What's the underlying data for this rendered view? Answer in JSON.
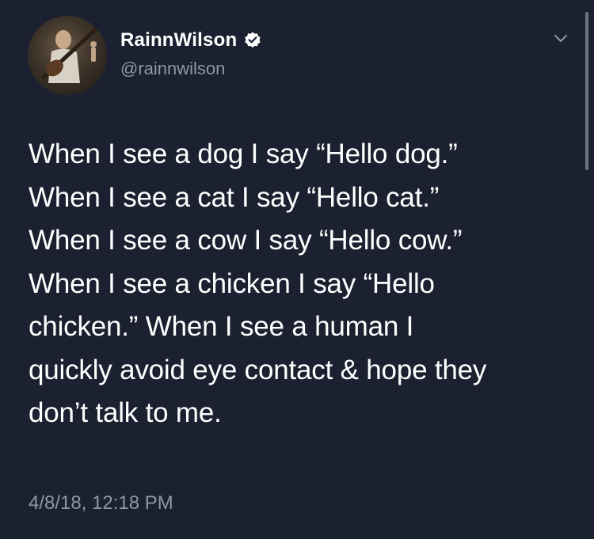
{
  "user": {
    "display_name": "RainnWilson",
    "handle": "@rainnwilson",
    "verified": true,
    "avatar_icon": "user-avatar-photo"
  },
  "tweet": {
    "text": "When I see a dog I say “Hello dog.”\nWhen I see a cat I say “Hello cat.”\nWhen I see a cow I say “Hello cow.”\nWhen I see a chicken I say “Hello\nchicken.” When I see a human I\nquickly avoid eye contact & hope they\ndon’t talk to me.",
    "timestamp": "4/8/18, 12:18 PM"
  },
  "icons": {
    "verified": "verified-badge-icon",
    "menu": "chevron-down-icon"
  },
  "colors": {
    "background": "#1b2130",
    "primary_text": "#ffffff",
    "secondary_text": "#8b98a5"
  }
}
